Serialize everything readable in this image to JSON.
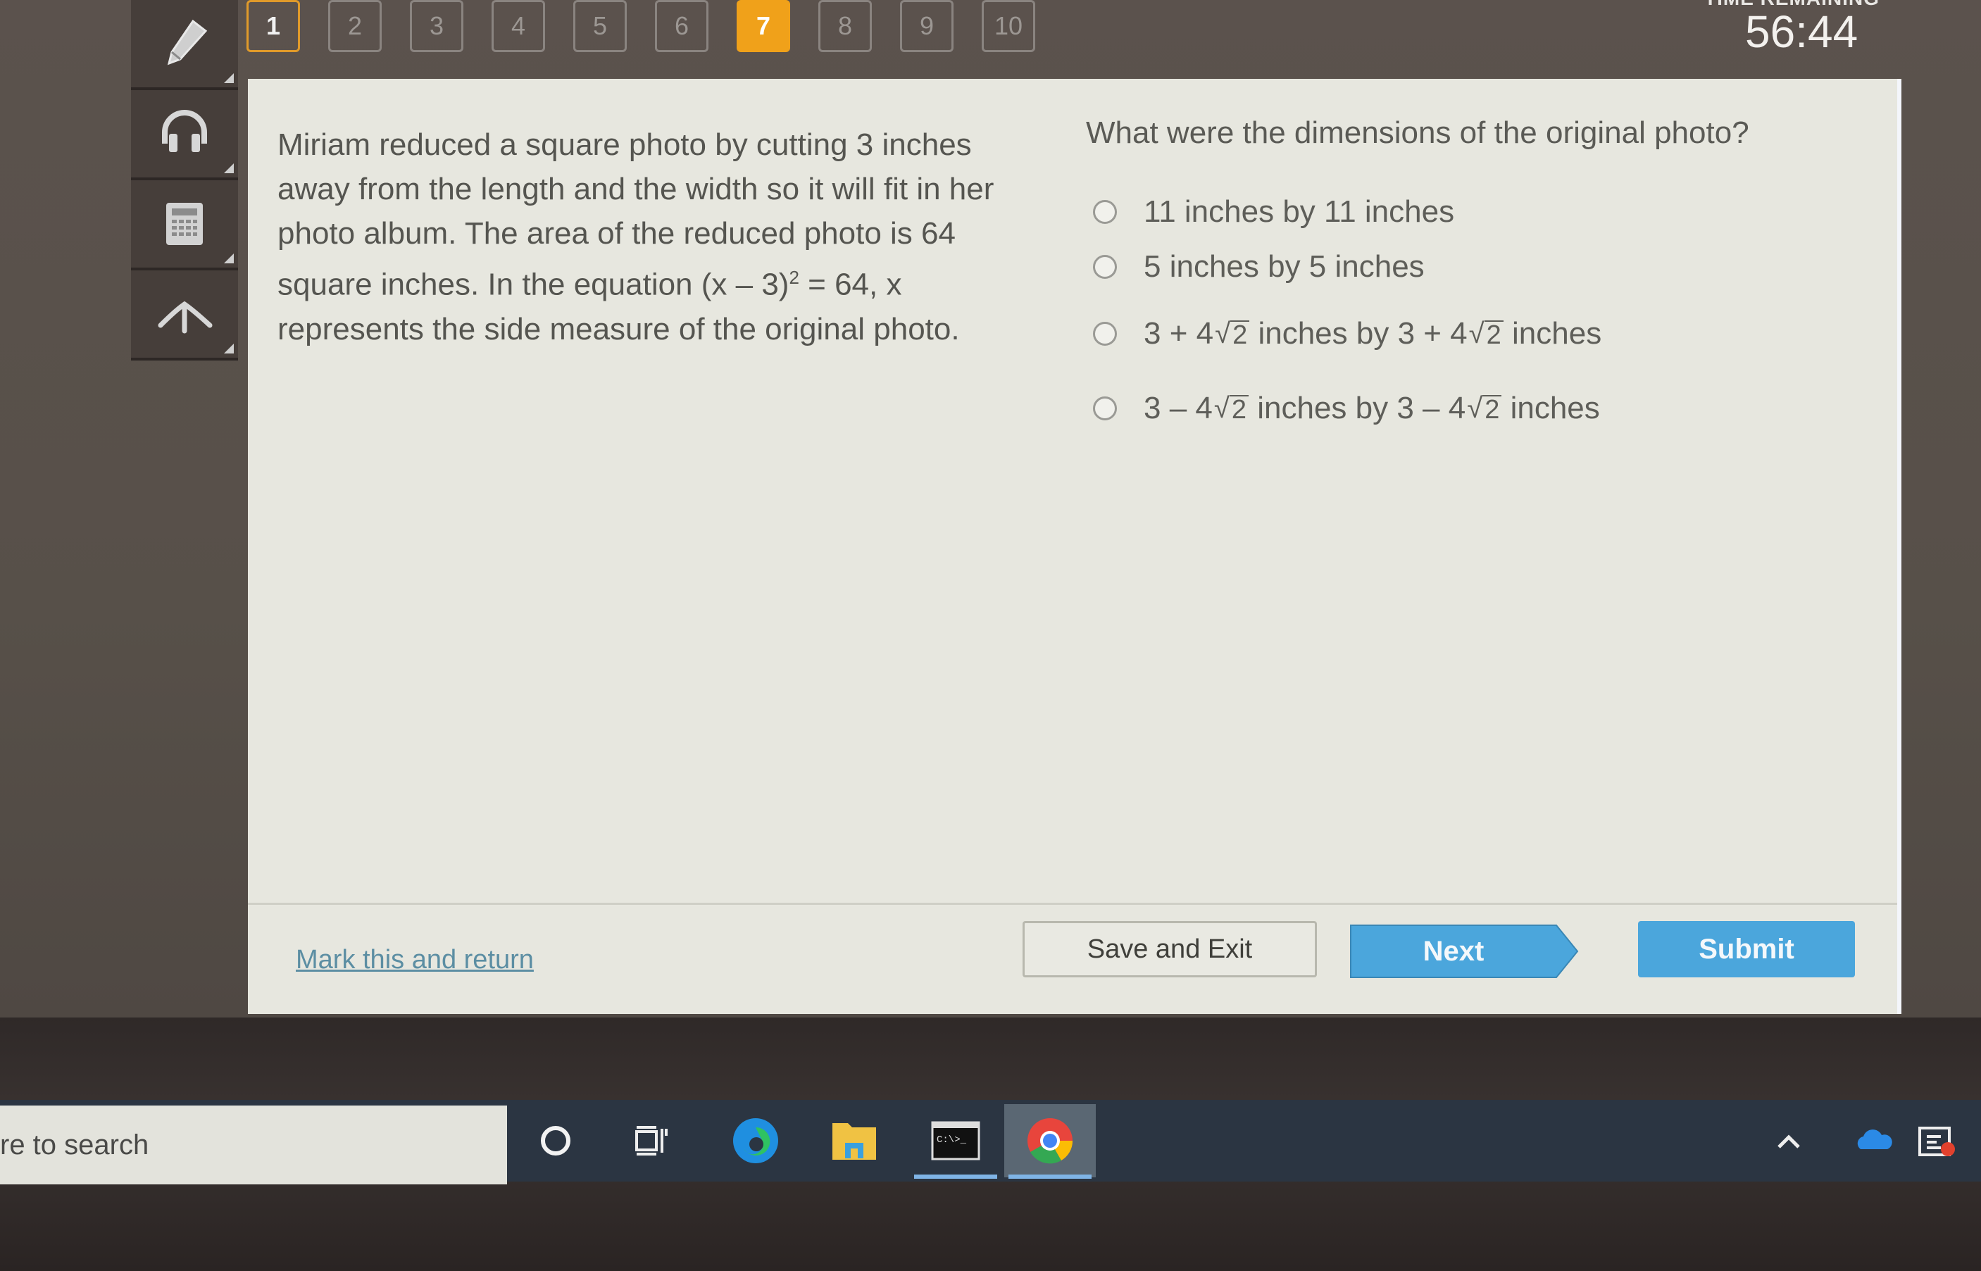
{
  "nav": {
    "questions": [
      {
        "label": "1",
        "state": "visited"
      },
      {
        "label": "2",
        "state": "unvisited"
      },
      {
        "label": "3",
        "state": "unvisited"
      },
      {
        "label": "4",
        "state": "unvisited"
      },
      {
        "label": "5",
        "state": "unvisited"
      },
      {
        "label": "6",
        "state": "unvisited"
      },
      {
        "label": "7",
        "state": "current"
      },
      {
        "label": "8",
        "state": "unvisited"
      },
      {
        "label": "9",
        "state": "unvisited"
      },
      {
        "label": "10",
        "state": "unvisited"
      }
    ]
  },
  "timer": {
    "label": "TIME REMAINING",
    "value": "56:44"
  },
  "tools": [
    "pencil-icon",
    "headphones-icon",
    "calculator-icon",
    "reference-arrow-icon"
  ],
  "question": {
    "passage_before": "Miriam reduced a square photo by cutting 3 inches away from the length and the width so it will fit in her photo album. The area of the reduced photo is 64 square inches. In the equation (x – 3)",
    "exponent": "2",
    "passage_after": " = 64, x represents the side measure of the original photo.",
    "prompt": "What were the dimensions of the original photo?",
    "options": [
      {
        "text": "11 inches by 11 inches"
      },
      {
        "text": "5 inches by 5 inches"
      },
      {
        "a": "3 + 4",
        "r": "2",
        "b": " inches by 3 + 4",
        "r2": "2",
        "c": " inches"
      },
      {
        "a": "3 – 4",
        "r": "2",
        "b": " inches by 3 – 4",
        "r2": "2",
        "c": " inches"
      }
    ]
  },
  "footer": {
    "mark_label": "Mark this and return",
    "save_label": "Save and Exit",
    "next_label": "Next",
    "submit_label": "Submit"
  },
  "colors": {
    "accent_orange": "#f0a11a",
    "button_blue": "#4ba6dc",
    "link": "#5c8ea3"
  },
  "taskbar": {
    "search_text": "re to search",
    "apps": [
      "cortana-icon",
      "task-view-icon",
      "edge-icon",
      "file-explorer-icon",
      "terminal-icon",
      "chrome-icon"
    ],
    "tray": [
      "show-hidden-icons-chevron",
      "onedrive-icon",
      "action-center-icon"
    ]
  }
}
